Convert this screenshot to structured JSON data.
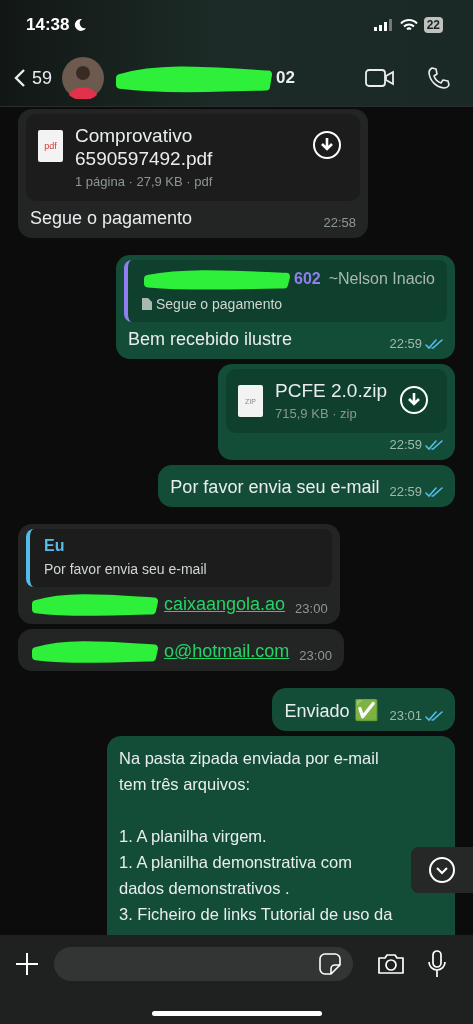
{
  "status_bar": {
    "time": "14:38",
    "battery": "22"
  },
  "header": {
    "back_count": "59",
    "contact_name": "02",
    "name_redacted": true
  },
  "messages": [
    {
      "kind": "file",
      "outgoing": false,
      "file_type": "pdf",
      "file_name": "Comprovativo 6590597492.pdf",
      "file_meta": "1 página · 27,9 KB · pdf",
      "caption": "Segue o pagamento",
      "time": "22:58"
    },
    {
      "kind": "quote",
      "outgoing": true,
      "quote_author": "602",
      "quote_author_redacted": true,
      "quote_note": "~Nelson Inacio",
      "quote_is_document": true,
      "quote_text": "Segue o pagamento",
      "text": "Bem recebido ilustre",
      "time": "22:59",
      "read": true
    },
    {
      "kind": "file",
      "outgoing": true,
      "file_type": "ZIP",
      "file_name": "PCFE 2.0.zip",
      "file_meta": "715,9 KB · zip",
      "time": "22:59",
      "read": true
    },
    {
      "kind": "text",
      "outgoing": true,
      "text": "Por favor envia seu e-mail",
      "time": "22:59",
      "read": true
    },
    {
      "kind": "quote",
      "outgoing": false,
      "quote_author": "Eu",
      "quote_is_document": false,
      "quote_text": "Por favor envia seu e-mail",
      "link": "caixaangola.ao",
      "link_redacted": true,
      "time": "23:00"
    },
    {
      "kind": "link",
      "outgoing": false,
      "link": "o@hotmail.com",
      "link_redacted": true,
      "time": "23:00"
    },
    {
      "kind": "text",
      "outgoing": true,
      "text": "Enviado",
      "emoji": "✅",
      "time": "23:01",
      "read": true
    },
    {
      "kind": "text",
      "outgoing": true,
      "text": "Na pasta zipada enviada por e-mail tem três arquivos:\n\n1. A planilha virgem.\n1. A planilha demonstrativa com dados demonstrativos .\n3. Ficheiro de links Tutorial de uso da"
    }
  ]
}
